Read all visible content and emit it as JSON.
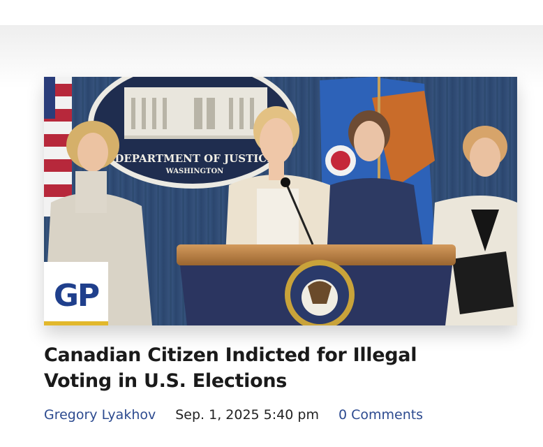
{
  "article": {
    "image_alt": "Press conference at a Department of Justice podium",
    "seal_text_top": "DEPARTMENT OF JUSTICE",
    "seal_text_bottom": "WASHINGTON",
    "badge": "GP",
    "title": "Canadian Citizen Indicted for Illegal Voting in U.S. Elections",
    "author": "Gregory Lyakhov",
    "date": "Sep. 1, 2025 5:40 pm",
    "comments": "0 Comments"
  },
  "colors": {
    "link": "#2c4a8f",
    "badge_blue": "#1f3f8c",
    "badge_gold": "#e2b82c",
    "curtain": "#2e4a72",
    "podium": "#2b3560"
  }
}
